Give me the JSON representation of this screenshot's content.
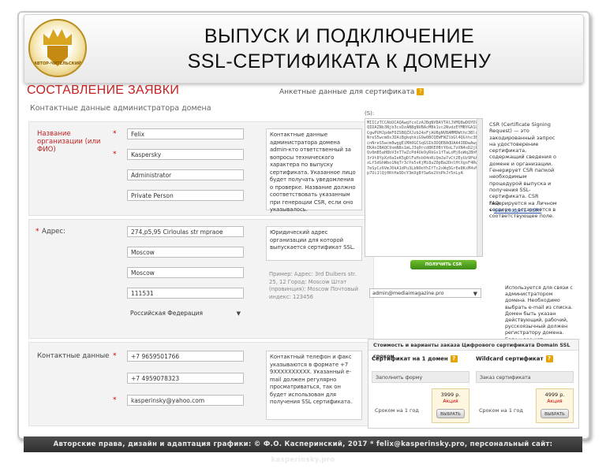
{
  "title": {
    "line1": "ВЫПУСК И ПОДКЛЮЧЕНИЕ",
    "line2": "SSL-СЕРТИФИКАТА К ДОМЕНУ"
  },
  "logo": {
    "text": "АВТОР-ЧИТЕЛЬСКИЙ"
  },
  "section_heading": "СОСТАВЛЕНИЕ ЗАЯВКИ",
  "left_panel": {
    "subtitle": "Контактные данные администратора домена",
    "block1": {
      "org_label": "Название организации (или ФИО)",
      "fields": [
        "Felix",
        "Kaspersky",
        "Administrator",
        "Private Person"
      ],
      "hint": "Контактные данные администратора домена admin-кто ответственный за вопросы технического характера по выпуску сертификата. Указанное лицо будет получать уведомления о проверке. Название должно соответствовать указанным при генерации CSR, если оно указывалось."
    },
    "block2": {
      "address_label": "Адрес:",
      "fields": [
        "274,p5,95 Cirloulas str mpraoe",
        "Moscow",
        "Moscow",
        "111531",
        "Российская Федерация"
      ],
      "hint_main": "Юридический адрес организации для которой выпускается сертификат SSL.",
      "hint_example": "Пример: Адрес: 3rd Duibers str. 25, 12 Город: Moscow Штат (провинция): Moscow Почтовый индекс: 123456"
    },
    "block3": {
      "contact_label": "Контактные данные",
      "fields": [
        "+7 9659501766",
        "+7 4959078323",
        "kasperinsky@yahoo.com"
      ],
      "hint": "Контактный телефон и факс указываются в формате +7 9XXXXXXXXXX. Указанный e-mail должен регулярно просматриваться, так он будет использован для получения SSL сертификата."
    }
  },
  "right_panel": {
    "title": "Анкетные данные для сертификата",
    "csr_label": "(S):",
    "csr_text": "MIICzTCCAbUCAQAwgYcxCzAJBgNVBAYTAlJVMQ8wDQYDVQQIDAZNb3Njb3cxDzANBgNVBAcMBk1vc2NvdzEYMBYGA1UECgwPUHJpdmF0ZSBQZXJzb24xFjAUBgNVBAMMDWthc3BlcnNreS5wcm8xJDAiBgkqhkiG9w0BCQEWFWZlbGl4QGthc3BlcnNreS5wcm8wggEiMA0GCSqGSIb3DQEBAQUAA4IBDwAwggEKAoIBAQC9xmN8s1mLJ3q0rcd8KE0BtY6oL7zXN4sD2jP1Qv0mB5aH8bV3nT7wZcPd4Ue9yRkGx1fTaLsMj6oWq2BhNc3rVt8YpXz0aIeK5gDlFuHsbO4nRiQmJw7vCt2EyUz9PkA6xLfSdGhWbo1NqTr3cYe5vKjMi8uZ0pBa2DnlHtXgsF4RwQ7eSyCz6VmJ0kA1dPu3LbN9oYhIfTc2xWq5GrEe8KsM4vNzp7Ui1lQj0RtHa9DcY3mXgBfSw6e2VoPkJr5nLyA",
    "generate_button": "ПОЛУЧИТЬ CSR АВТОМАТИЧЕСКИ",
    "csr_help": "CSR (Certificate Signing Request) — это закодированный запрос на удостоверение сертификата, содержащий сведения о домене и организации. Генерирует CSR папкой необходимым процедурой выпуска и получения SSL-сертификата. CSR генерируется на Личном сервере и вставляется в соответствующее поле.",
    "faq_title": "FAQ:",
    "faq_link": "Как создать CSR?",
    "email_select": "admin@mediaimagazine.pro",
    "email_help": "Используется для связи с администратором домена. Необходимо выбрать e-mail из списка. Домен быть указан действующий, рабочий, русскоязычный должен регистратору домена. Если у вас нет возможности выбрать, ошибки в домене.",
    "price_box": {
      "header": "Стоимость и варианты заказа Цифрового сертификата Domain SSL сроком",
      "col1": {
        "title": "Сертификат на 1 домен",
        "row": "Заполнить форму",
        "term": "Сроком на 1 год",
        "amount": "3999 р.",
        "promo": "Акция",
        "buy": "ВЫБРАТЬ"
      },
      "col2": {
        "title": "Wildcard сертификат",
        "row": "Заказ сертификата",
        "term": "Сроком на 1 год",
        "amount": "4999 р.",
        "promo": "Акция",
        "buy": "ВЫБРАТЬ"
      }
    }
  },
  "footer": "Авторские права, дизайн и адаптация графики: © Ф.О. Касперинский, 2017 *  felix@kasperinsky.pro, персональный сайт: kasperinsky.pro"
}
